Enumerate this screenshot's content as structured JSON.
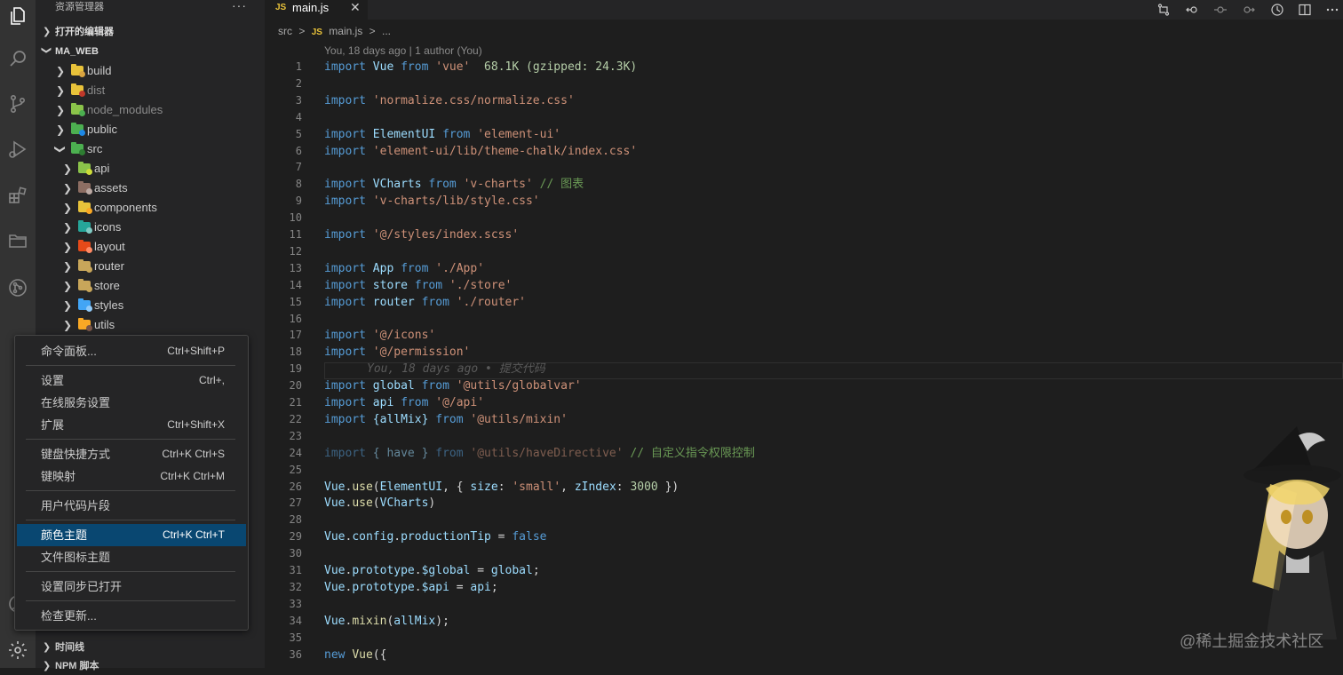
{
  "sidebar": {
    "title": "资源管理器",
    "more": "···",
    "sections": {
      "open_editors": "打开的编辑器",
      "project": "MA_WEB",
      "timeline": "时间线",
      "npm": "NPM 脚本"
    },
    "tree": [
      {
        "name": "build",
        "depth": 1,
        "color": "#e8c23a",
        "dot": "#d9a441",
        "dim": false,
        "open": false
      },
      {
        "name": "dist",
        "depth": 1,
        "color": "#e8c23a",
        "dot": "#c0392b",
        "dim": true,
        "open": false
      },
      {
        "name": "node_modules",
        "depth": 1,
        "color": "#8bc34a",
        "dot": "#4caf50",
        "dim": true,
        "open": false
      },
      {
        "name": "public",
        "depth": 1,
        "color": "#4caf50",
        "dot": "#1e88e5",
        "dim": false,
        "open": false
      },
      {
        "name": "src",
        "depth": 1,
        "color": "#4caf50",
        "dot": "#2e7d32",
        "dim": false,
        "open": true
      },
      {
        "name": "api",
        "depth": 2,
        "color": "#8bc34a",
        "dot": "#cddc39",
        "dim": false,
        "open": false
      },
      {
        "name": "assets",
        "depth": 2,
        "color": "#8d6e63",
        "dot": "#bcaaa4",
        "dim": false,
        "open": false
      },
      {
        "name": "components",
        "depth": 2,
        "color": "#e8c23a",
        "dot": "#f9a825",
        "dim": false,
        "open": false
      },
      {
        "name": "icons",
        "depth": 2,
        "color": "#26a69a",
        "dot": "#80cbc4",
        "dim": false,
        "open": false
      },
      {
        "name": "layout",
        "depth": 2,
        "color": "#e64a19",
        "dot": "#ff8a65",
        "dim": false,
        "open": false
      },
      {
        "name": "router",
        "depth": 2,
        "color": "#c8a65a",
        "dot": "#c8a65a",
        "dim": false,
        "open": false
      },
      {
        "name": "store",
        "depth": 2,
        "color": "#c8a65a",
        "dot": "#c8a65a",
        "dim": false,
        "open": false
      },
      {
        "name": "styles",
        "depth": 2,
        "color": "#42a5f5",
        "dot": "#90caf9",
        "dim": false,
        "open": false
      },
      {
        "name": "utils",
        "depth": 2,
        "color": "#f9a825",
        "dot": "#795548",
        "dim": false,
        "open": false
      }
    ]
  },
  "tab": {
    "lang": "JS",
    "name": "main.js",
    "close": "✕"
  },
  "breadcrumb": {
    "folder": "src",
    "sep": ">",
    "lang": "JS",
    "file": "main.js",
    "more": "..."
  },
  "blame_top": "You, 18 days ago | 1 author (You)",
  "ghost_blame": "You, 18 days ago • 提交代码",
  "code": [
    [
      [
        "kw",
        "import "
      ],
      [
        "id",
        "Vue "
      ],
      [
        "kw",
        "from "
      ],
      [
        "str",
        "'vue'"
      ],
      [
        "sz",
        "  68.1K (gzipped: 24.3K)"
      ]
    ],
    [],
    [
      [
        "kw",
        "import "
      ],
      [
        "str",
        "'normalize.css/normalize.css'"
      ]
    ],
    [],
    [
      [
        "kw",
        "import "
      ],
      [
        "id",
        "ElementUI "
      ],
      [
        "kw",
        "from "
      ],
      [
        "str",
        "'element-ui'"
      ]
    ],
    [
      [
        "kw",
        "import "
      ],
      [
        "str",
        "'element-ui/lib/theme-chalk/index.css'"
      ]
    ],
    [],
    [
      [
        "kw",
        "import "
      ],
      [
        "id",
        "VCharts "
      ],
      [
        "kw",
        "from "
      ],
      [
        "str",
        "'v-charts'"
      ],
      [
        "cmt",
        " // 图表"
      ]
    ],
    [
      [
        "kw",
        "import "
      ],
      [
        "str",
        "'v-charts/lib/style.css'"
      ]
    ],
    [],
    [
      [
        "kw",
        "import "
      ],
      [
        "str",
        "'@/styles/index.scss'"
      ]
    ],
    [],
    [
      [
        "kw",
        "import "
      ],
      [
        "id",
        "App "
      ],
      [
        "kw",
        "from "
      ],
      [
        "str",
        "'./App'"
      ]
    ],
    [
      [
        "kw",
        "import "
      ],
      [
        "id",
        "store "
      ],
      [
        "kw",
        "from "
      ],
      [
        "str",
        "'./store'"
      ]
    ],
    [
      [
        "kw",
        "import "
      ],
      [
        "id",
        "router "
      ],
      [
        "kw",
        "from "
      ],
      [
        "str",
        "'./router'"
      ]
    ],
    [],
    [
      [
        "kw",
        "import "
      ],
      [
        "str",
        "'@/icons'"
      ]
    ],
    [
      [
        "kw",
        "import "
      ],
      [
        "str",
        "'@/permission'"
      ]
    ],
    [],
    [
      [
        "kw",
        "import "
      ],
      [
        "id",
        "global "
      ],
      [
        "kw",
        "from "
      ],
      [
        "str",
        "'@utils/globalvar'"
      ]
    ],
    [
      [
        "kw",
        "import "
      ],
      [
        "id",
        "api "
      ],
      [
        "kw",
        "from "
      ],
      [
        "str",
        "'@/api'"
      ]
    ],
    [
      [
        "kw",
        "import "
      ],
      [
        "id",
        "{allMix} "
      ],
      [
        "kw",
        "from "
      ],
      [
        "str",
        "'@utils/mixin'"
      ]
    ],
    [],
    [
      [
        "kw faded",
        "import "
      ],
      [
        "id faded",
        "{ have } "
      ],
      [
        "kw faded",
        "from "
      ],
      [
        "str faded",
        "'@utils/haveDirective'"
      ],
      [
        "cmt",
        " // 自定义指令权限控制"
      ]
    ],
    [],
    [
      [
        "id",
        "Vue"
      ],
      [
        "p",
        "."
      ],
      [
        "fn",
        "use"
      ],
      [
        "p",
        "("
      ],
      [
        "id",
        "ElementUI"
      ],
      [
        "p",
        ", { "
      ],
      [
        "id",
        "size"
      ],
      [
        "p",
        ": "
      ],
      [
        "str",
        "'small'"
      ],
      [
        "p",
        ", "
      ],
      [
        "id",
        "zIndex"
      ],
      [
        "p",
        ": "
      ],
      [
        "num",
        "3000"
      ],
      [
        "p",
        " })"
      ]
    ],
    [
      [
        "id",
        "Vue"
      ],
      [
        "p",
        "."
      ],
      [
        "fn",
        "use"
      ],
      [
        "p",
        "("
      ],
      [
        "id",
        "VCharts"
      ],
      [
        "p",
        ")"
      ]
    ],
    [],
    [
      [
        "id",
        "Vue"
      ],
      [
        "p",
        "."
      ],
      [
        "id",
        "config"
      ],
      [
        "p",
        "."
      ],
      [
        "id",
        "productionTip"
      ],
      [
        "p",
        " = "
      ],
      [
        "kw",
        "false"
      ]
    ],
    [],
    [
      [
        "id",
        "Vue"
      ],
      [
        "p",
        "."
      ],
      [
        "id",
        "prototype"
      ],
      [
        "p",
        "."
      ],
      [
        "id",
        "$global"
      ],
      [
        "p",
        " = "
      ],
      [
        "id",
        "global"
      ],
      [
        "p",
        ";"
      ]
    ],
    [
      [
        "id",
        "Vue"
      ],
      [
        "p",
        "."
      ],
      [
        "id",
        "prototype"
      ],
      [
        "p",
        "."
      ],
      [
        "id",
        "$api"
      ],
      [
        "p",
        " = "
      ],
      [
        "id",
        "api"
      ],
      [
        "p",
        ";"
      ]
    ],
    [],
    [
      [
        "id",
        "Vue"
      ],
      [
        "p",
        "."
      ],
      [
        "fn",
        "mixin"
      ],
      [
        "p",
        "("
      ],
      [
        "id",
        "allMix"
      ],
      [
        "p",
        ");"
      ]
    ],
    [],
    [
      [
        "kw",
        "new "
      ],
      [
        "fn",
        "Vue"
      ],
      [
        "p",
        "({"
      ]
    ]
  ],
  "menu": [
    {
      "label": "命令面板...",
      "key": "Ctrl+Shift+P"
    },
    {
      "sep": true
    },
    {
      "label": "设置",
      "key": "Ctrl+,"
    },
    {
      "label": "在线服务设置",
      "key": ""
    },
    {
      "label": "扩展",
      "key": "Ctrl+Shift+X"
    },
    {
      "sep": true
    },
    {
      "label": "键盘快捷方式",
      "key": "Ctrl+K Ctrl+S"
    },
    {
      "label": "键映射",
      "key": "Ctrl+K Ctrl+M"
    },
    {
      "sep": true
    },
    {
      "label": "用户代码片段",
      "key": ""
    },
    {
      "sep": true
    },
    {
      "label": "颜色主题",
      "key": "Ctrl+K Ctrl+T",
      "selected": true
    },
    {
      "label": "文件图标主题",
      "key": ""
    },
    {
      "sep": true
    },
    {
      "label": "设置同步已打开",
      "key": ""
    },
    {
      "sep": true
    },
    {
      "label": "检查更新...",
      "key": ""
    }
  ],
  "watermark": "@稀土掘金技术社区",
  "colors": {
    "accent_selected": "#094771",
    "editor_bg": "#1e1e1e",
    "sidebar_bg": "#252526",
    "activity_bg": "#333333"
  },
  "icons": {
    "activity": [
      "files-icon",
      "search-icon",
      "source-control-icon",
      "run-debug-icon",
      "extensions-icon",
      "folder-icon",
      "git-graph-icon",
      "account-icon",
      "gear-icon"
    ],
    "title_actions": [
      "open-changes-icon",
      "go-back-icon",
      "git-commit-icon",
      "go-forward-icon",
      "timeline-icon",
      "split-editor-icon",
      "more-actions-icon"
    ]
  }
}
